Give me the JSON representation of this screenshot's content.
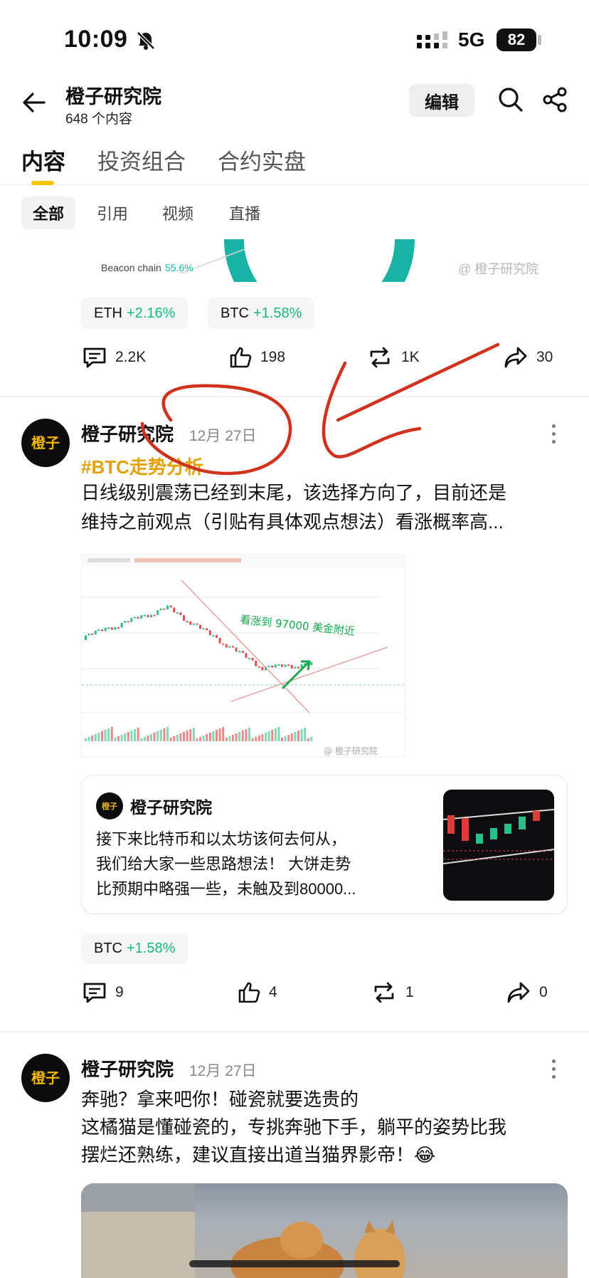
{
  "status_bar": {
    "time": "10:09",
    "network": "5G",
    "battery": "82"
  },
  "header": {
    "title": "橙子研究院",
    "subtitle": "648 个内容",
    "edit_label": "编辑"
  },
  "tabs": [
    {
      "label": "内容",
      "active": true
    },
    {
      "label": "投资组合",
      "active": false
    },
    {
      "label": "合约实盘",
      "active": false
    }
  ],
  "filters": [
    {
      "label": "全部",
      "active": true
    },
    {
      "label": "引用",
      "active": false
    },
    {
      "label": "视频",
      "active": false
    },
    {
      "label": "直播",
      "active": false
    }
  ],
  "post1": {
    "legend_label": "Beacon chain",
    "legend_value": "55.6%",
    "watermark": "@ 橙子研究院",
    "tickers": [
      {
        "symbol": "ETH",
        "change": "+2.16%"
      },
      {
        "symbol": "BTC",
        "change": "+1.58%"
      }
    ],
    "comments": "2.2K",
    "likes": "198",
    "reposts": "1K",
    "shares": "30"
  },
  "post2": {
    "author": "橙子研究院",
    "date": "12月 27日",
    "hashtag": "#BTC走势分析",
    "text_line1": "日线级别震荡已经到末尾，该选择方向了，目前还是",
    "text_line2": "维持之前观点（引贴有具体观点想法）看涨概率高...",
    "chart_annotation": "看涨到 97000 美金附近",
    "chart_watermark": "@ 橙子研究院",
    "quote": {
      "author": "橙子研究院",
      "line1": "接下来比特币和以太坊该何去何从，",
      "line2": "我们给大家一些思路想法！ 大饼走势",
      "line3": "比预期中略强一些，未触及到80000..."
    },
    "ticker": {
      "symbol": "BTC",
      "change": "+1.58%"
    },
    "comments": "9",
    "likes": "4",
    "reposts": "1",
    "shares": "0"
  },
  "post3": {
    "author": "橙子研究院",
    "date": "12月 27日",
    "line1": "奔驰？拿来吧你！碰瓷就要选贵的",
    "line2": "这橘猫是懂碰瓷的，专挑奔驰下手，躺平的姿势比我",
    "line3": "摆烂还熟练，建议直接出道当猫界影帝！😂"
  },
  "avatar_text": "橙子",
  "colors": {
    "accent": "#f7c600",
    "up": "#17b67a",
    "hashtag": "#e2a100",
    "teal": "#19b3a6",
    "annotation_red": "#d0321e"
  }
}
